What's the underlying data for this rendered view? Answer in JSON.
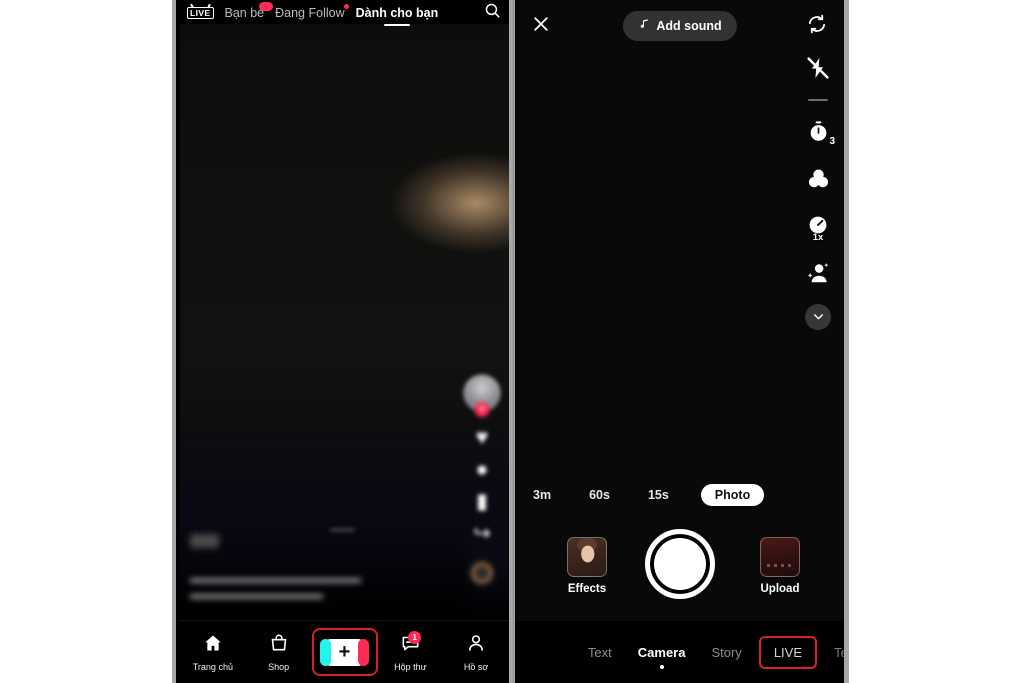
{
  "meta": {
    "app": "TikTok",
    "colors": {
      "brand_pink": "#fe2c55",
      "brand_cyan": "#25f4ee",
      "highlight_red": "#d81f2a",
      "background": "#ffffff",
      "panel_bg": "#000000"
    }
  },
  "feed": {
    "top_tabs": [
      {
        "label": "LIVE",
        "icon": "live-badge-icon",
        "active": false,
        "badge": false
      },
      {
        "label": "Bạn bè",
        "active": false,
        "badge": true
      },
      {
        "label": "Đang Follow",
        "active": false,
        "badge": true
      },
      {
        "label": "Dành cho bạn",
        "active": true,
        "badge": false
      }
    ],
    "search_icon": "search-icon",
    "action_rail": {
      "avatar_icon": "avatar-icon",
      "follow_icon": "plus-icon",
      "items": [
        {
          "icon": "heart-icon",
          "count": ""
        },
        {
          "icon": "comment-icon",
          "count": ""
        },
        {
          "icon": "bookmark-icon",
          "count": ""
        },
        {
          "icon": "share-icon",
          "count": ""
        }
      ],
      "music_disc_icon": "music-disc-icon"
    },
    "caption": {
      "badge": "",
      "username": "",
      "line1": "",
      "line2": ""
    },
    "timestamp": "",
    "bottom_nav": [
      {
        "label": "Trang chủ",
        "icon": "home-icon",
        "badge": ""
      },
      {
        "label": "Shop",
        "icon": "shop-bag-icon",
        "badge": ""
      },
      {
        "label": "",
        "icon": "plus-create-icon",
        "badge": "",
        "highlighted": true
      },
      {
        "label": "Hộp thư",
        "icon": "inbox-message-icon",
        "badge": "1"
      },
      {
        "label": "Hồ sơ",
        "icon": "profile-person-icon",
        "badge": ""
      }
    ]
  },
  "camera": {
    "top": {
      "close_icon": "close-x-icon",
      "add_sound_label": "Add sound",
      "music_note_icon": "music-note-icon",
      "flip_icon": "flip-camera-icon"
    },
    "tools": [
      {
        "name": "flash-off-icon",
        "label": "",
        "sub": ""
      },
      {
        "name": "timer-icon",
        "label": "",
        "sub": "3"
      },
      {
        "name": "filters-icon",
        "label": "",
        "sub": ""
      },
      {
        "name": "speed-icon",
        "label": "",
        "sub": "1x"
      },
      {
        "name": "beautify-icon",
        "label": "",
        "sub": ""
      },
      {
        "name": "chevron-down-icon",
        "label": "",
        "sub": ""
      }
    ],
    "durations": [
      {
        "label": "3m",
        "selected": false
      },
      {
        "label": "60s",
        "selected": false
      },
      {
        "label": "15s",
        "selected": false
      },
      {
        "label": "Photo",
        "selected": true
      }
    ],
    "effects_label": "Effects",
    "upload_label": "Upload",
    "shutter_label": "",
    "modes": [
      {
        "label": "Text",
        "active": false,
        "highlighted": false
      },
      {
        "label": "Camera",
        "active": true,
        "highlighted": false
      },
      {
        "label": "Story",
        "active": false,
        "highlighted": false
      },
      {
        "label": "LIVE",
        "active": false,
        "highlighted": true
      },
      {
        "label": "Te",
        "active": false,
        "highlighted": false,
        "cut": true
      }
    ]
  }
}
